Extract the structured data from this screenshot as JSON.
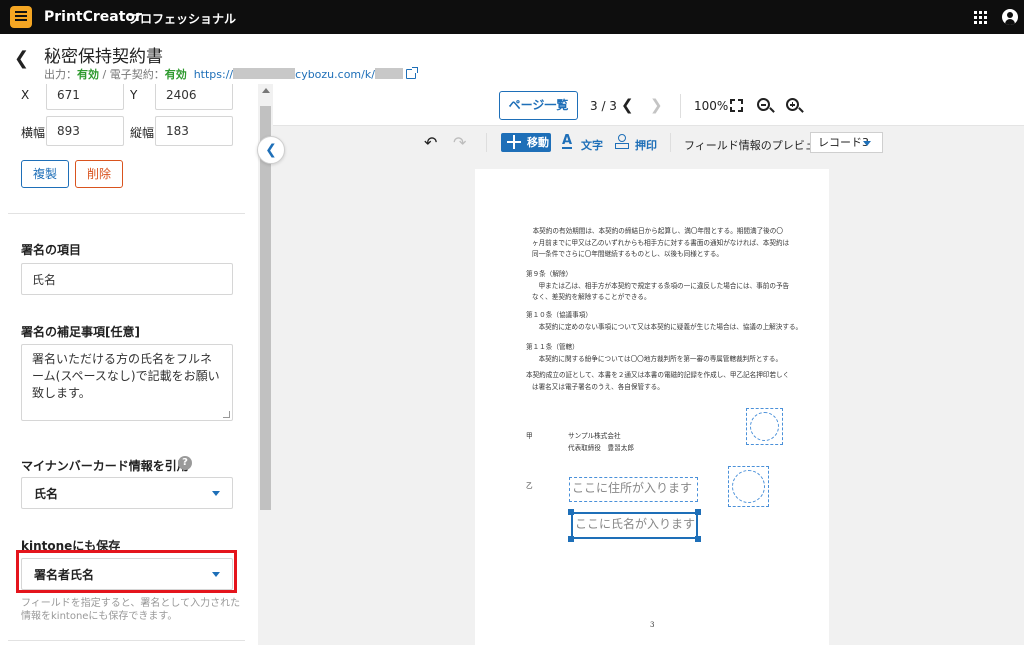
{
  "app": {
    "name": "PrintCreator",
    "edition": "プロフェッショナル"
  },
  "header": {
    "title": "秘密保持契約書",
    "output_label": "出力：",
    "output_value": "有効",
    "separator": " / ",
    "esign_label": "電子契約：",
    "esign_value": "有効",
    "url_prefix": "https://",
    "url_middle": "cybozu.com/k/"
  },
  "left_panel": {
    "x_label": "X",
    "x_value": "671",
    "y_label": "Y",
    "y_value": "2406",
    "width_label": "横幅",
    "width_value": "893",
    "height_label": "縦幅",
    "height_value": "183",
    "copy_button": "複製",
    "delete_button": "削除",
    "signature_item_label": "署名の項目",
    "signature_item_value": "氏名",
    "supplement_label": "署名の補足事項[任意]",
    "supplement_value": "署名いただける方の氏名をフルネーム(スペースなし)で記載をお願い致します。",
    "mynumber_label": "マイナンバーカード情報を引用",
    "mynumber_value": "氏名",
    "kintone_label": "kintoneにも保存",
    "kintone_value": "署名者氏名",
    "kintone_hint": "フィールドを指定すると、署名として入力された情報をkintoneにも保存できます。"
  },
  "toolbar": {
    "page_list_button": "ページ一覧",
    "page_indicator": "3 / 3",
    "zoom_level": "100%",
    "move_tool": "移動",
    "text_tool": "文字",
    "stamp_tool": "押印",
    "field_preview_label": "フィールド情報のプレビュー",
    "record_select": "レコード3"
  },
  "document": {
    "paragraph1": [
      "　本契約の有効期間は、本契約の締結日から起算し、満〇年間とする。期間満了後の〇",
      "ヶ月前までに甲又は乙のいずれからも相手方に対する書面の通知がなければ、本契約は",
      "同一条件でさらに〇年間継続するものとし、以後も同様とする。"
    ],
    "art9_title": "第９条（解除）",
    "art9_body": [
      "　甲または乙は、相手方が本契約で規定する条項の一に違反した場合には、事前の予告",
      "なく、差契約を解除することができる。"
    ],
    "art10_title": "第１０条（協議事項）",
    "art10_body": [
      "　本契約に定めのない事項について又は本契約に疑義が生じた場合は、協議の上解決する。"
    ],
    "art11_title": "第１１条（管轄）",
    "art11_body": [
      "　本契約に関する紛争については〇〇地方裁判所を第一審の専属管轄裁判所とする。"
    ],
    "closing": [
      "本契約成立の証として、本書を２通又は本書の電磁的記録を作成し、甲乙記名押印若しく",
      "は署名又は電子署名のうえ、各自保管する。"
    ],
    "party_a_mark": "甲",
    "party_a_company": "サンプル株式会社",
    "party_a_rep": "代表取締役　豊習太郎",
    "party_b_mark": "乙",
    "address_placeholder": "ここに住所が入ります",
    "name_placeholder": "ここに氏名が入ります",
    "page_number": "3"
  },
  "colors": {
    "accent": "#1e6fb8",
    "danger": "#d9531e",
    "highlight": "#e4141c",
    "status_ok": "#2e9a2e"
  }
}
